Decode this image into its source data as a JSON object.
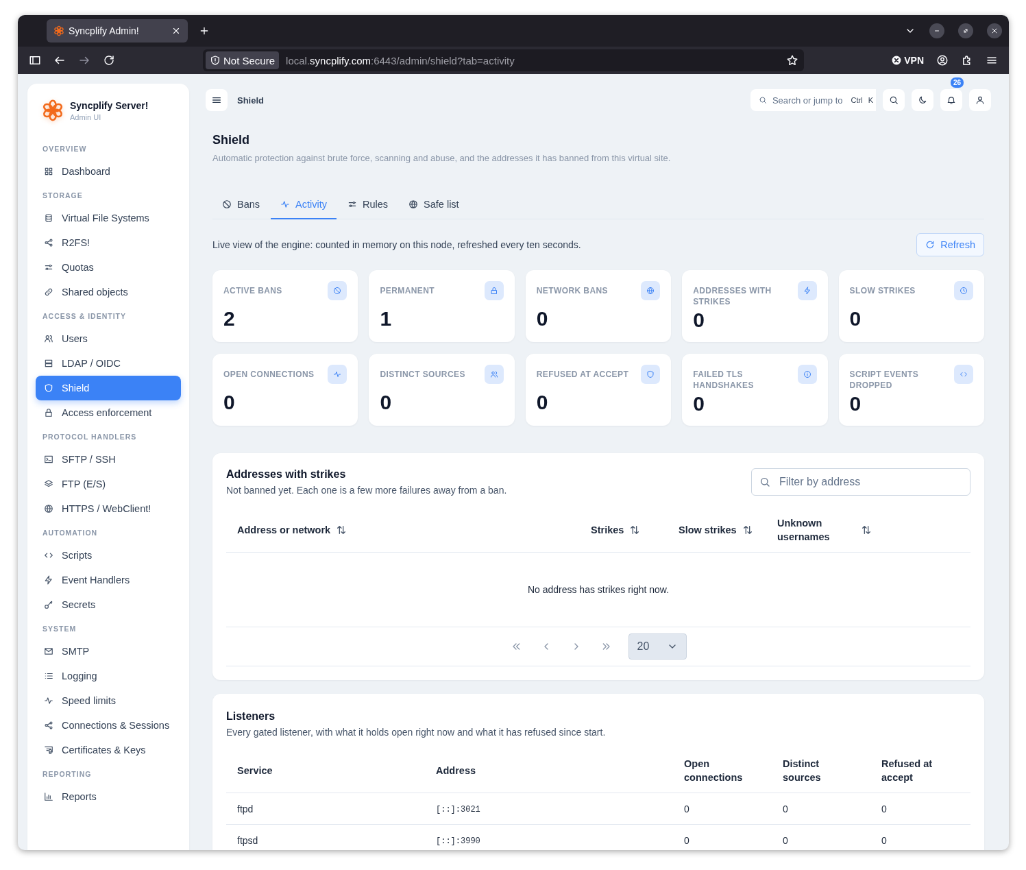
{
  "browser": {
    "tab_title": "Syncplify Admin!",
    "security_label": "Not Secure",
    "url_parts": [
      {
        "text": "local.",
        "emphasized": false
      },
      {
        "text": "syncplify.com",
        "emphasized": true
      },
      {
        "text": ":6443/admin/shield?tab=activity",
        "emphasized": false
      }
    ],
    "vpn_label": "VPN"
  },
  "sidebar": {
    "brand": {
      "name": "Syncplify Server!",
      "subtitle": "Admin UI"
    },
    "sections": [
      {
        "heading": "OVERVIEW",
        "items": [
          {
            "label": "Dashboard",
            "selected": false
          }
        ]
      },
      {
        "heading": "STORAGE",
        "items": [
          {
            "label": "Virtual File Systems",
            "selected": false
          },
          {
            "label": "R2FS!",
            "selected": false
          },
          {
            "label": "Quotas",
            "selected": false
          },
          {
            "label": "Shared objects",
            "selected": false
          }
        ]
      },
      {
        "heading": "ACCESS & IDENTITY",
        "items": [
          {
            "label": "Users",
            "selected": false
          },
          {
            "label": "LDAP / OIDC",
            "selected": false
          },
          {
            "label": "Shield",
            "selected": true
          },
          {
            "label": "Access enforcement",
            "selected": false
          }
        ]
      },
      {
        "heading": "PROTOCOL HANDLERS",
        "items": [
          {
            "label": "SFTP / SSH",
            "selected": false
          },
          {
            "label": "FTP (E/S)",
            "selected": false
          },
          {
            "label": "HTTPS / WebClient!",
            "selected": false
          }
        ]
      },
      {
        "heading": "AUTOMATION",
        "items": [
          {
            "label": "Scripts",
            "selected": false
          },
          {
            "label": "Event Handlers",
            "selected": false
          },
          {
            "label": "Secrets",
            "selected": false
          }
        ]
      },
      {
        "heading": "SYSTEM",
        "items": [
          {
            "label": "SMTP",
            "selected": false
          },
          {
            "label": "Logging",
            "selected": false
          },
          {
            "label": "Speed limits",
            "selected": false
          },
          {
            "label": "Connections & Sessions",
            "selected": false
          },
          {
            "label": "Certificates & Keys",
            "selected": false
          }
        ]
      },
      {
        "heading": "REPORTING",
        "items": [
          {
            "label": "Reports",
            "selected": false
          }
        ]
      }
    ]
  },
  "topbar": {
    "breadcrumb": "Shield",
    "search_label": "Search or jump to",
    "shortcut_keys": [
      "Ctrl",
      "K"
    ],
    "notification_count": "26"
  },
  "page": {
    "title": "Shield",
    "description": "Automatic protection against brute force, scanning and abuse, and the addresses it has banned from this virtual site."
  },
  "tabs": [
    {
      "label": "Bans",
      "selected": false
    },
    {
      "label": "Activity",
      "selected": true
    },
    {
      "label": "Rules",
      "selected": false
    },
    {
      "label": "Safe list",
      "selected": false
    }
  ],
  "activity": {
    "note": "Live view of the engine: counted in memory on this node, refreshed every ten seconds.",
    "refresh_label": "Refresh",
    "stats": [
      {
        "label": "ACTIVE BANS",
        "value": "2"
      },
      {
        "label": "PERMANENT",
        "value": "1"
      },
      {
        "label": "NETWORK BANS",
        "value": "0"
      },
      {
        "label": "ADDRESSES WITH STRIKES",
        "value": "0"
      },
      {
        "label": "SLOW STRIKES",
        "value": "0"
      },
      {
        "label": "OPEN CONNECTIONS",
        "value": "0"
      },
      {
        "label": "DISTINCT SOURCES",
        "value": "0"
      },
      {
        "label": "REFUSED AT ACCEPT",
        "value": "0"
      },
      {
        "label": "FAILED TLS HANDSHAKES",
        "value": "0"
      },
      {
        "label": "SCRIPT EVENTS DROPPED",
        "value": "0"
      }
    ]
  },
  "strikes_panel": {
    "title": "Addresses with strikes",
    "subtitle": "Not banned yet. Each one is a few more failures away from a ban.",
    "filter_placeholder": "Filter by address",
    "columns": [
      {
        "label": "Address or network",
        "sortable": true
      },
      {
        "label": "Strikes",
        "sortable": true
      },
      {
        "label": "Slow strikes",
        "sortable": true
      },
      {
        "label": "Unknown usernames",
        "sortable": true
      }
    ],
    "empty_message": "No address has strikes right now.",
    "page_size": "20"
  },
  "listeners_panel": {
    "title": "Listeners",
    "subtitle": "Every gated listener, with what it holds open right now and what it has refused since start.",
    "columns": [
      {
        "label": "Service",
        "monospace": false
      },
      {
        "label": "Address",
        "monospace": true
      },
      {
        "label": "Open connections",
        "monospace": false
      },
      {
        "label": "Distinct sources",
        "monospace": false
      },
      {
        "label": "Refused at accept",
        "monospace": false
      }
    ],
    "rows": [
      [
        "ftpd",
        "[::]:3021",
        "0",
        "0",
        "0"
      ],
      [
        "ftpsd",
        "[::]:3990",
        "0",
        "0",
        "0"
      ]
    ]
  }
}
